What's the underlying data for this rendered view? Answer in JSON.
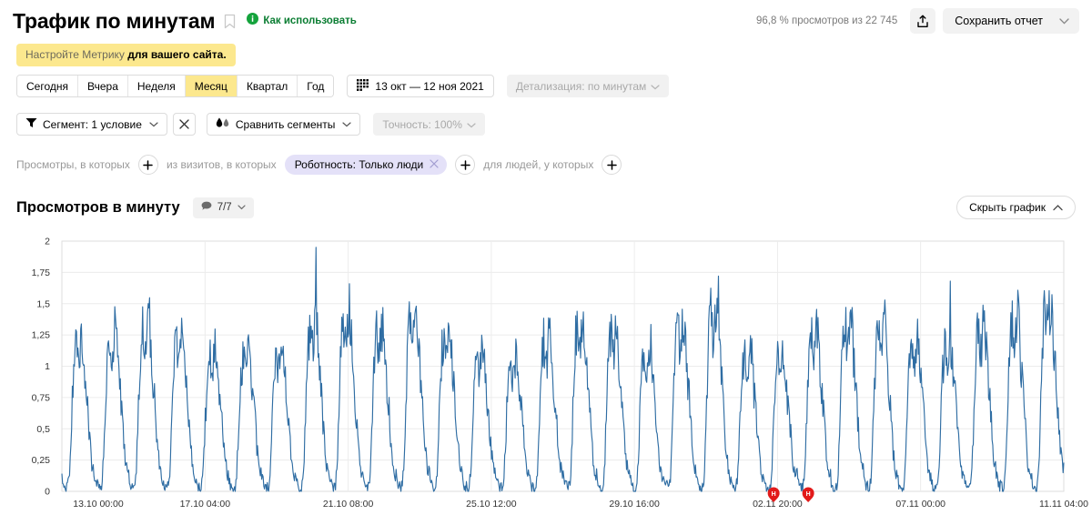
{
  "header": {
    "title": "Трафик по минутам",
    "bookmark_icon": "bookmark-icon",
    "info_icon": "info-circle-icon",
    "howto_label": "Как использовать",
    "views_count": "96,8 % просмотров из 22 745",
    "share_icon": "share-upload-icon",
    "save_report_label": "Сохранить отчет",
    "save_report_chevron": "chevron-down-icon"
  },
  "notice": {
    "muted_text": "Настройте Метрику ",
    "strong_text": "для вашего сайта."
  },
  "period": {
    "tabs": [
      {
        "label": "Сегодня",
        "active": false
      },
      {
        "label": "Вчера",
        "active": false
      },
      {
        "label": "Неделя",
        "active": false
      },
      {
        "label": "Месяц",
        "active": true
      },
      {
        "label": "Квартал",
        "active": false
      },
      {
        "label": "Год",
        "active": false
      }
    ],
    "date_range": "13 окт — 12 ноя 2021",
    "calendar_icon": "calendar-icon",
    "detail_label": "Детализация: по минутам",
    "detail_chevron": "chevron-down-icon"
  },
  "segments": {
    "segment_icon": "filter-funnel-icon",
    "segment_label": "Сегмент: 1 условие",
    "clear_icon": "close-x-icon",
    "compare_icon": "compare-segments-icon",
    "compare_label": "Сравнить сегменты",
    "accuracy_label": "Точность: 100%",
    "accuracy_chevron": "chevron-down-icon"
  },
  "filters": {
    "label_views": "Просмотры, в которых",
    "label_visits": "из визитов, в которых",
    "label_people": "для людей, у которых",
    "chip_label": "Роботность: Только люди",
    "chip_remove_icon": "close-x-icon",
    "add_icon": "plus-icon"
  },
  "chart_header": {
    "title": "Просмотров в минуту",
    "comments_icon": "comment-bubble-icon",
    "comments_label": "7/7",
    "comments_chevron": "chevron-down-icon",
    "hide_chart_label": "Скрыть график",
    "hide_chart_chevron": "chevron-up-icon"
  },
  "chart_data": {
    "type": "line",
    "title": "Просмотров в минуту",
    "xlabel": "",
    "ylabel": "",
    "ylim": [
      0,
      2
    ],
    "yticks": [
      "0",
      "0,25",
      "0,5",
      "0,75",
      "1",
      "1,25",
      "1,5",
      "1,75",
      "2"
    ],
    "ytick_values": [
      0,
      0.25,
      0.5,
      0.75,
      1,
      1.25,
      1.5,
      1.75,
      2
    ],
    "grid": true,
    "legend": "none",
    "xticks": [
      "13.10 00:00",
      "17.10 04:00",
      "21.10 08:00",
      "25.10 12:00",
      "29.10 16:00",
      "02.11 20:00",
      "07.11 00:00",
      "11.11 04:00"
    ],
    "xtick_fractions": [
      0.0,
      0.1429,
      0.2857,
      0.4286,
      0.5714,
      0.7143,
      0.8571,
      1.0
    ],
    "x_range_start": "13.10.2021 00:00",
    "x_range_end": "12.11.2021 23:59",
    "series": [
      {
        "name": "Просмотров в минуту",
        "color": "#2f6da3",
        "n_days": 30,
        "samples_per_day": 48,
        "daily_profile": [
          0.12,
          0.07,
          0.05,
          0.04,
          0.03,
          0.03,
          0.02,
          0.02,
          0.03,
          0.05,
          0.09,
          0.16,
          0.28,
          0.42,
          0.58,
          0.72,
          0.86,
          0.98,
          1.08,
          1.14,
          1.18,
          1.16,
          1.1,
          1.04,
          1.02,
          1.06,
          1.12,
          1.18,
          1.22,
          1.24,
          1.2,
          1.12,
          1.02,
          0.92,
          0.84,
          0.78,
          0.72,
          0.66,
          0.58,
          0.5,
          0.42,
          0.34,
          0.28,
          0.23,
          0.19,
          0.16,
          0.14,
          0.13
        ],
        "day_scale": [
          0.98,
          1.05,
          1.12,
          1.0,
          0.94,
          0.88,
          0.92,
          1.08,
          1.14,
          1.06,
          1.18,
          1.02,
          0.9,
          0.86,
          1.0,
          1.1,
          1.04,
          0.96,
          1.12,
          1.2,
          0.92,
          0.88,
          1.06,
          1.16,
          1.1,
          1.0,
          0.94,
          1.08,
          1.14,
          1.22
        ],
        "peak_spikes": [
          {
            "day": 7,
            "slot": 29,
            "value": 1.95
          },
          {
            "day": 19,
            "slot": 31,
            "value": 1.72
          },
          {
            "day": 26,
            "slot": 28,
            "value": 1.68
          }
        ],
        "min_value": 0.0,
        "max_value": 1.95,
        "noise_amplitude": 0.26
      }
    ],
    "annotations": [
      {
        "type": "holiday-pin",
        "label": "Н",
        "x_fraction": 0.7104,
        "color": "#e21a1a"
      },
      {
        "type": "holiday-pin",
        "label": "Н",
        "x_fraction": 0.7449,
        "color": "#e21a1a"
      }
    ]
  }
}
